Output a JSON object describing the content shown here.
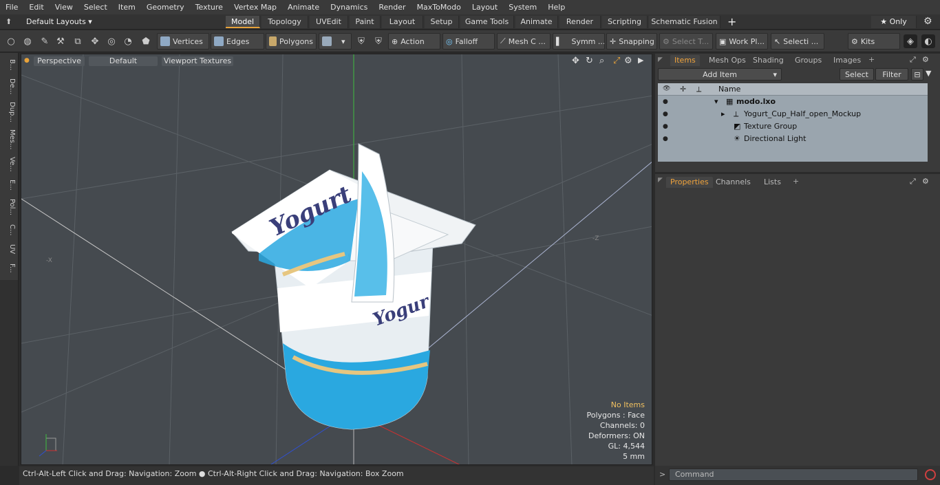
{
  "menu": [
    "File",
    "Edit",
    "View",
    "Select",
    "Item",
    "Geometry",
    "Texture",
    "Vertex Map",
    "Animate",
    "Dynamics",
    "Render",
    "MaxToModo",
    "Layout",
    "System",
    "Help"
  ],
  "layout_selector": "Default Layouts ▾",
  "layout_tabs": [
    "Model",
    "Topology",
    "UVEdit",
    "Paint",
    "Layout",
    "Setup",
    "Game Tools",
    "Animate",
    "Render",
    "Scripting",
    "Schematic Fusion"
  ],
  "layout_add": "+",
  "only_label": "★ Only",
  "toolbar": {
    "vertices": "Vertices",
    "edges": "Edges",
    "polygons": "Polygons",
    "action": "Action",
    "falloff": "Falloff",
    "mesh": "Mesh C ...",
    "symm": "Symm ...",
    "snapping": "Snapping",
    "select_t": "Select T...",
    "work_pl": "Work Pl...",
    "selecti": "Selecti ...",
    "kits": "Kits"
  },
  "left_tabs": [
    "B...",
    "De...",
    "Dup...",
    "Mes...",
    "Ve...",
    "E...",
    "Pol...",
    "C...",
    "UV",
    "F..."
  ],
  "viewport": {
    "perspective": "Perspective",
    "default": "Default",
    "textures": "Viewport Textures",
    "label_neg_x": "-X",
    "label_neg_z": "-Z",
    "info": {
      "items": "No Items",
      "polygons": "Polygons : Face",
      "channels": "Channels: 0",
      "deformers": "Deformers: ON",
      "gl": "GL: 4,544",
      "unit": "5 mm"
    }
  },
  "status_text": "Ctrl-Alt-Left Click and Drag: Navigation: Zoom ● Ctrl-Alt-Right Click and Drag: Navigation: Box Zoom",
  "items_panel": {
    "tabs": [
      "Items",
      "Mesh Ops",
      "Shading",
      "Groups",
      "Images"
    ],
    "add_item": "Add Item",
    "select": "Select",
    "filter": "Filter",
    "column_name": "Name",
    "rows": [
      "modo.lxo",
      "Yogurt_Cup_Half_open_Mockup",
      "Texture Group",
      "Directional Light"
    ]
  },
  "properties_panel": {
    "tabs": [
      "Properties",
      "Channels",
      "Lists"
    ]
  },
  "command_placeholder": "Command",
  "colors": {
    "accent": "#f0a33c",
    "grid_green": "#3fbf3f",
    "axis_red": "#d03030",
    "axis_blue": "#3050d0",
    "cup_blue": "#2aa8e0"
  }
}
